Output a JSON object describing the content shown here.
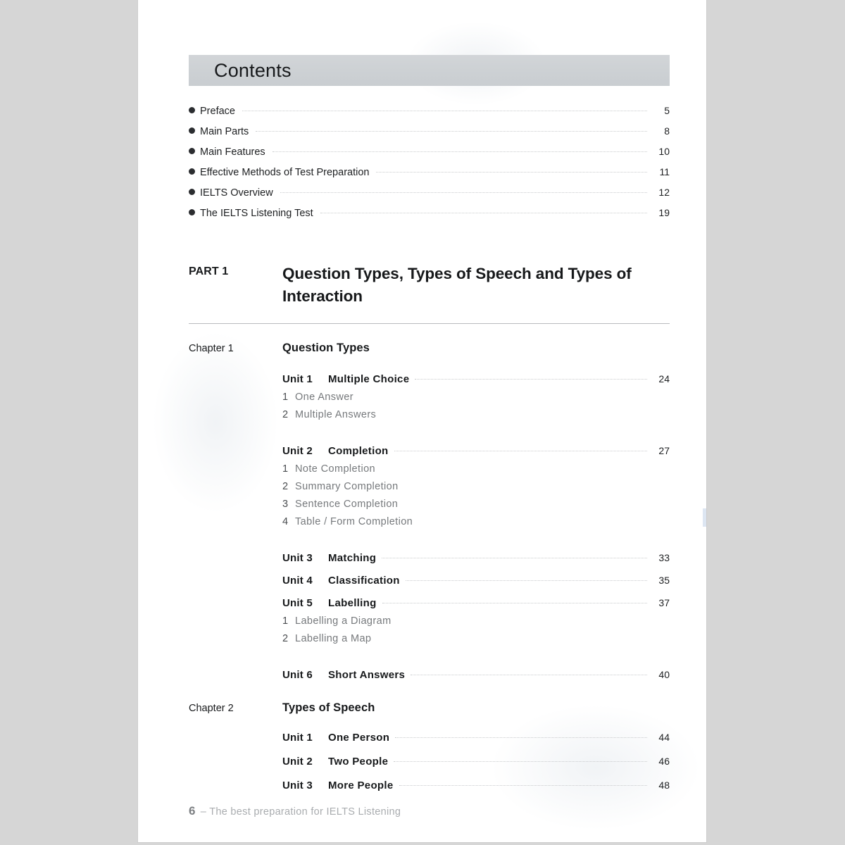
{
  "document": {
    "heading": "Contents",
    "footer": {
      "page_number": "6",
      "text": "– The best preparation for IELTS Listening"
    }
  },
  "front_matter": [
    {
      "label": "Preface",
      "page": "5"
    },
    {
      "label": "Main Parts",
      "page": "8"
    },
    {
      "label": "Main Features",
      "page": "10"
    },
    {
      "label": "Effective Methods of Test Preparation",
      "page": "11"
    },
    {
      "label": "IELTS Overview",
      "page": "12"
    },
    {
      "label": "The IELTS Listening Test",
      "page": "19"
    }
  ],
  "part": {
    "label": "PART 1",
    "title": "Question Types, Types of Speech and Types of Interaction"
  },
  "chapters": [
    {
      "label": "Chapter 1",
      "title": "Question Types",
      "units": [
        {
          "number": "Unit 1",
          "name": "Multiple Choice",
          "page": "24",
          "subitems": [
            {
              "number": "1",
              "name": "One Answer"
            },
            {
              "number": "2",
              "name": "Multiple Answers"
            }
          ]
        },
        {
          "number": "Unit 2",
          "name": "Completion",
          "page": "27",
          "subitems": [
            {
              "number": "1",
              "name": "Note Completion"
            },
            {
              "number": "2",
              "name": "Summary Completion"
            },
            {
              "number": "3",
              "name": "Sentence Completion"
            },
            {
              "number": "4",
              "name": "Table / Form Completion"
            }
          ]
        },
        {
          "number": "Unit 3",
          "name": "Matching",
          "page": "33",
          "subitems": []
        },
        {
          "number": "Unit 4",
          "name": "Classification",
          "page": "35",
          "subitems": []
        },
        {
          "number": "Unit 5",
          "name": "Labelling",
          "page": "37",
          "subitems": [
            {
              "number": "1",
              "name": "Labelling a Diagram"
            },
            {
              "number": "2",
              "name": "Labelling a Map"
            }
          ]
        },
        {
          "number": "Unit 6",
          "name": "Short Answers",
          "page": "40",
          "subitems": []
        }
      ]
    },
    {
      "label": "Chapter 2",
      "title": "Types of Speech",
      "units": [
        {
          "number": "Unit 1",
          "name": "One Person",
          "page": "44",
          "subitems": []
        },
        {
          "number": "Unit 2",
          "name": "Two People",
          "page": "46",
          "subitems": []
        },
        {
          "number": "Unit 3",
          "name": "More People",
          "page": "48",
          "subitems": []
        }
      ]
    }
  ],
  "colors": {
    "page_background": "#d6d6d6",
    "paper": "#ffffff",
    "title_bar": "#cdd1d4",
    "text": "#17191b",
    "subtext": "#76797c",
    "leader": "#c9cbcd",
    "rule": "#b9bbbd"
  }
}
